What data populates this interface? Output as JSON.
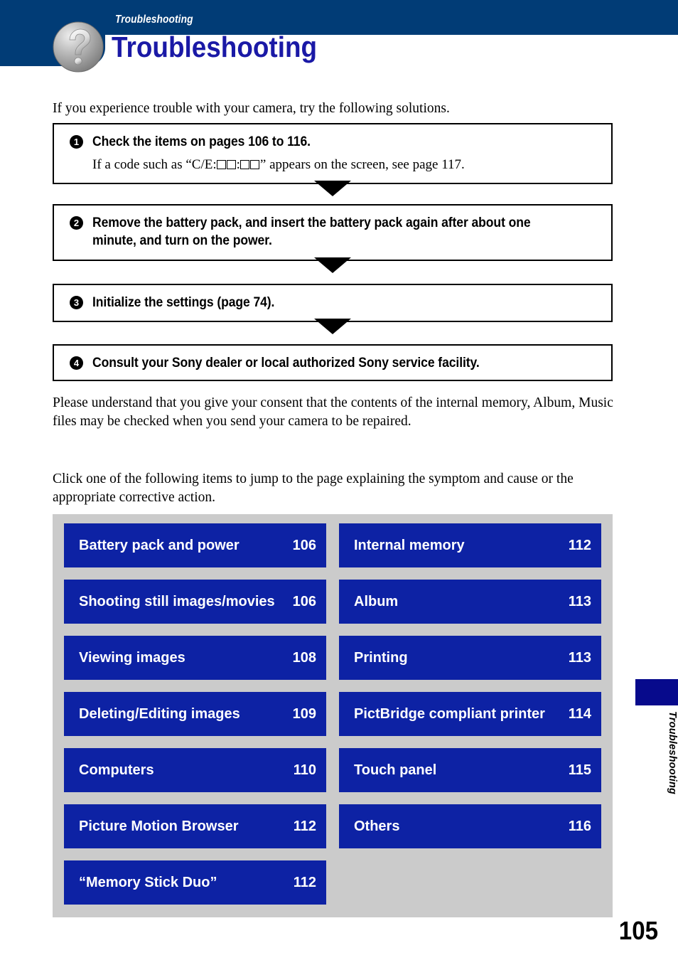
{
  "header": {
    "eyebrow": "Troubleshooting",
    "title": "Troubleshooting",
    "icon": "question-mark-icon",
    "bar_color": "#013C76",
    "title_color": "#1A19A6"
  },
  "intro": {
    "text": "If you experience trouble with your camera, try the following solutions."
  },
  "steps": [
    {
      "number": "1",
      "heading": "Check the items on pages 106 to 116.",
      "sub_before": "If a code such as “C/E:",
      "sub_mid": ":",
      "sub_after": "” appears on the screen, see page 117."
    },
    {
      "number": "2",
      "heading": "Remove the battery pack, and insert the battery pack again after about one minute, and turn on the power."
    },
    {
      "number": "3",
      "heading": "Initialize the settings (page 74)."
    },
    {
      "number": "4",
      "heading": "Consult your Sony dealer or local authorized Sony service facility."
    }
  ],
  "consent": {
    "text": "Please understand that you give your consent that the contents of the internal memory, Album, Music files may be checked when you send your camera to be repaired."
  },
  "click_note": {
    "text": "Click one of the following items to jump to the page explaining the symptom and cause or the appropriate corrective action."
  },
  "link_grid": {
    "panel_color": "#CBCBCB",
    "item_color": "#0D22A4",
    "left_column": [
      {
        "label": "Battery pack and power",
        "page": "106"
      },
      {
        "label": "Shooting still images/movies",
        "page": "106"
      },
      {
        "label": "Viewing images",
        "page": "108"
      },
      {
        "label": "Deleting/Editing images",
        "page": "109"
      },
      {
        "label": "Computers",
        "page": "110"
      },
      {
        "label": "Picture Motion Browser",
        "page": "112"
      },
      {
        "label": "“Memory Stick Duo”",
        "page": "112"
      }
    ],
    "right_column": [
      {
        "label": "Internal memory",
        "page": "112"
      },
      {
        "label": "Album",
        "page": "113"
      },
      {
        "label": "Printing",
        "page": "113"
      },
      {
        "label": "PictBridge compliant printer",
        "page": "114"
      },
      {
        "label": "Touch panel",
        "page": "115"
      },
      {
        "label": "Others",
        "page": "116"
      }
    ]
  },
  "side_tab": {
    "label": "Troubleshooting",
    "color": "#070A8C"
  },
  "page_number": "105"
}
